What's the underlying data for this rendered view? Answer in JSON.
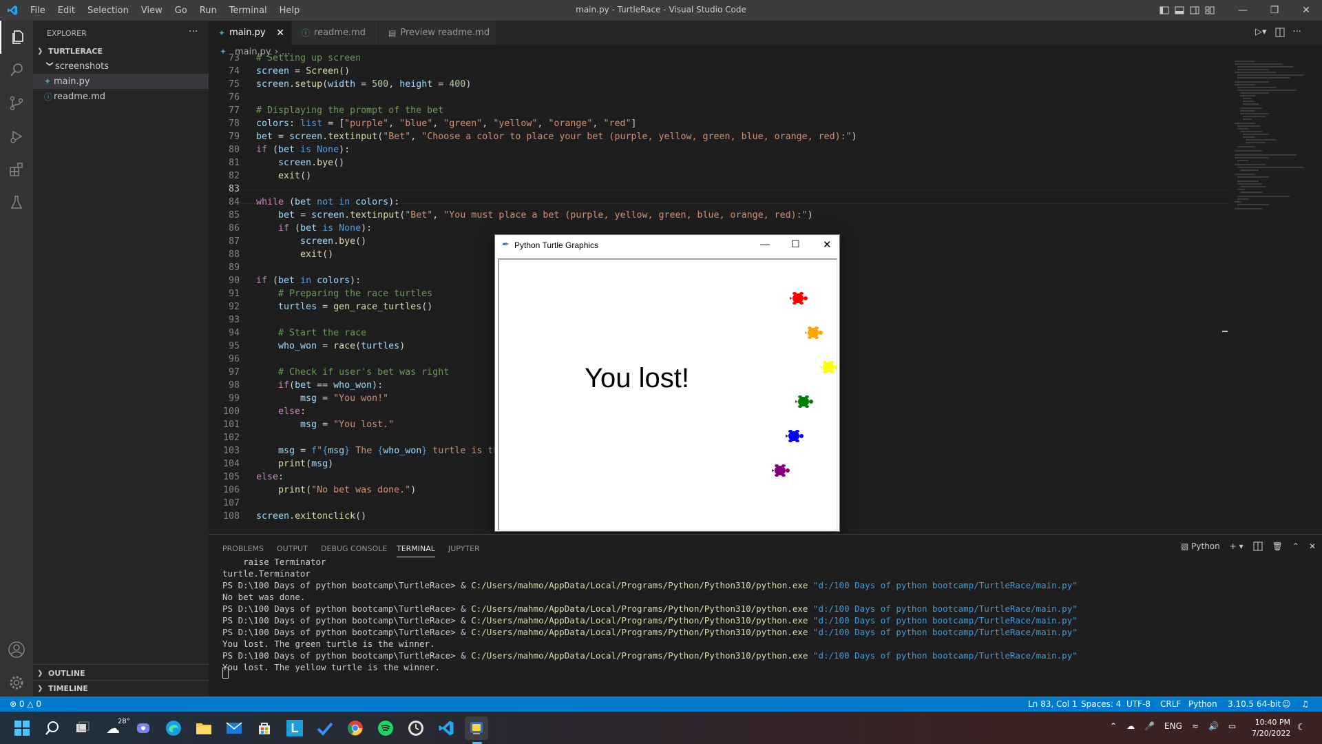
{
  "window": {
    "title": "main.py - TurtleRace - Visual Studio Code",
    "menu": [
      "File",
      "Edit",
      "Selection",
      "View",
      "Go",
      "Run",
      "Terminal",
      "Help"
    ]
  },
  "sidebar": {
    "title": "EXPLORER",
    "more": "···",
    "project": "TURTLERACE",
    "items": [
      {
        "label": "screenshots",
        "icon": "folder-icon"
      },
      {
        "label": "main.py",
        "icon": "python-file-icon"
      },
      {
        "label": "readme.md",
        "icon": "info-icon"
      }
    ],
    "outline": "OUTLINE",
    "timeline": "TIMELINE"
  },
  "tabs": [
    {
      "label": "main.py",
      "active": true
    },
    {
      "label": "readme.md",
      "active": false
    },
    {
      "label": "Preview readme.md",
      "active": false
    }
  ],
  "breadcrumb": {
    "file": "main.py",
    "rest": "..."
  },
  "editor": {
    "current_line": 83,
    "lines": [
      {
        "n": "73",
        "html": "<span class='cm'># Setting up screen</span>"
      },
      {
        "n": "74",
        "html": "<span class='vr'>screen</span> = <span class='fn'>Screen</span>()"
      },
      {
        "n": "75",
        "html": "<span class='vr'>screen</span>.<span class='fn'>setup</span>(<span class='vr'>width</span> = <span class='nm'>500</span>, <span class='vr'>height</span> = <span class='nm'>400</span>)"
      },
      {
        "n": "76",
        "html": ""
      },
      {
        "n": "77",
        "html": "<span class='cm'># Displaying the prompt of the bet</span>"
      },
      {
        "n": "78",
        "html": "<span class='vr'>colors</span>: <span class='bl'>list</span> = [<span class='st'>\"purple\"</span>, <span class='st'>\"blue\"</span>, <span class='st'>\"green\"</span>, <span class='st'>\"yellow\"</span>, <span class='st'>\"orange\"</span>, <span class='st'>\"red\"</span>]"
      },
      {
        "n": "79",
        "html": "<span class='vr'>bet</span> = <span class='vr'>screen</span>.<span class='fn'>textinput</span>(<span class='st'>\"Bet\"</span>, <span class='st'>\"Choose a color to place your bet (purple, yellow, green, blue, orange, red):\"</span>)"
      },
      {
        "n": "80",
        "html": "<span class='kw'>if</span> (<span class='vr'>bet</span> <span class='bl'>is</span> <span class='bl'>None</span>):"
      },
      {
        "n": "81",
        "html": "    <span class='vr'>screen</span>.<span class='fn'>bye</span>()"
      },
      {
        "n": "82",
        "html": "    <span class='fn'>exit</span>()"
      },
      {
        "n": "83",
        "html": ""
      },
      {
        "n": "84",
        "html": "<span class='kw'>while</span> (<span class='vr'>bet</span> <span class='bl'>not in</span> <span class='vr'>colors</span>):"
      },
      {
        "n": "85",
        "html": "    <span class='vr'>bet</span> = <span class='vr'>screen</span>.<span class='fn'>textinput</span>(<span class='st'>\"Bet\"</span>, <span class='st'>\"You must place a bet (purple, yellow, green, blue, orange, red):\"</span>)"
      },
      {
        "n": "86",
        "html": "    <span class='kw'>if</span> (<span class='vr'>bet</span> <span class='bl'>is</span> <span class='bl'>None</span>):"
      },
      {
        "n": "87",
        "html": "        <span class='vr'>screen</span>.<span class='fn'>bye</span>()"
      },
      {
        "n": "88",
        "html": "        <span class='fn'>exit</span>()"
      },
      {
        "n": "89",
        "html": ""
      },
      {
        "n": "90",
        "html": "<span class='kw'>if</span> (<span class='vr'>bet</span> <span class='bl'>in</span> <span class='vr'>colors</span>):"
      },
      {
        "n": "91",
        "html": "    <span class='cm'># Preparing the race turtles</span>"
      },
      {
        "n": "92",
        "html": "    <span class='vr'>turtles</span> = <span class='fn'>gen_race_turtles</span>()"
      },
      {
        "n": "93",
        "html": ""
      },
      {
        "n": "94",
        "html": "    <span class='cm'># Start the race</span>"
      },
      {
        "n": "95",
        "html": "    <span class='vr'>who_won</span> = <span class='fn'>race</span>(<span class='vr'>turtles</span>)"
      },
      {
        "n": "96",
        "html": ""
      },
      {
        "n": "97",
        "html": "    <span class='cm'># Check if user's bet was right</span>"
      },
      {
        "n": "98",
        "html": "    <span class='kw'>if</span>(<span class='vr'>bet</span> == <span class='vr'>who_won</span>):"
      },
      {
        "n": "99",
        "html": "        <span class='vr'>msg</span> = <span class='st'>\"You won!\"</span>"
      },
      {
        "n": "100",
        "html": "    <span class='kw'>else</span>:"
      },
      {
        "n": "101",
        "html": "        <span class='vr'>msg</span> = <span class='st'>\"You lost.\"</span>"
      },
      {
        "n": "102",
        "html": ""
      },
      {
        "n": "103",
        "html": "    <span class='vr'>msg</span> = <span class='bl'>f</span><span class='st'>\"</span><span class='bl'>{</span><span class='vr'>msg</span><span class='bl'>}</span><span class='st'> The </span><span class='bl'>{</span><span class='vr'>who_won</span><span class='bl'>}</span><span class='st'> turtle is the</span>"
      },
      {
        "n": "104",
        "html": "    <span class='fn'>print</span>(<span class='vr'>msg</span>)"
      },
      {
        "n": "105",
        "html": "<span class='kw'>else</span>:"
      },
      {
        "n": "106",
        "html": "    <span class='fn'>print</span>(<span class='st'>\"No bet was done.\"</span>)"
      },
      {
        "n": "107",
        "html": ""
      },
      {
        "n": "108",
        "html": "<span class='vr'>screen</span>.<span class='fn'>exitonclick</span>()"
      }
    ]
  },
  "turtle_window": {
    "title": "Python Turtle Graphics",
    "message": "You lost!",
    "turtles": [
      "#ff0000",
      "#ffa500",
      "#ffff00",
      "#008000",
      "#0000ff",
      "#800080"
    ]
  },
  "panel": {
    "tabs": [
      "PROBLEMS",
      "OUTPUT",
      "DEBUG CONSOLE",
      "TERMINAL",
      "JUPYTER"
    ],
    "active_tab": "TERMINAL",
    "shell": "Python",
    "terminal_lines": [
      {
        "plain": "    raise Terminator"
      },
      {
        "plain": "turtle.Terminator"
      },
      {
        "prompt": "PS D:\\100 Days of python bootcamp\\TurtleRace> & ",
        "path": "C:/Users/mahmo/AppData/Local/Programs/Python/Python310/python.exe",
        "arg": " \"d:/100 Days of python bootcamp/TurtleRace/main.py\""
      },
      {
        "plain": "No bet was done."
      },
      {
        "prompt": "PS D:\\100 Days of python bootcamp\\TurtleRace> & ",
        "path": "C:/Users/mahmo/AppData/Local/Programs/Python/Python310/python.exe",
        "arg": " \"d:/100 Days of python bootcamp/TurtleRace/main.py\""
      },
      {
        "prompt": "PS D:\\100 Days of python bootcamp\\TurtleRace> & ",
        "path": "C:/Users/mahmo/AppData/Local/Programs/Python/Python310/python.exe",
        "arg": " \"d:/100 Days of python bootcamp/TurtleRace/main.py\""
      },
      {
        "prompt": "PS D:\\100 Days of python bootcamp\\TurtleRace> & ",
        "path": "C:/Users/mahmo/AppData/Local/Programs/Python/Python310/python.exe",
        "arg": " \"d:/100 Days of python bootcamp/TurtleRace/main.py\""
      },
      {
        "plain": "You lost. The green turtle is the winner."
      },
      {
        "prompt": "PS D:\\100 Days of python bootcamp\\TurtleRace> & ",
        "path": "C:/Users/mahmo/AppData/Local/Programs/Python/Python310/python.exe",
        "arg": " \"d:/100 Days of python bootcamp/TurtleRace/main.py\""
      },
      {
        "plain": "You lost. The yellow turtle is the winner."
      }
    ]
  },
  "statusbar": {
    "errors": "0",
    "warnings": "0",
    "position": "Ln 83, Col 1",
    "spaces": "Spaces: 4",
    "encoding": "UTF-8",
    "eol": "CRLF",
    "language": "Python",
    "interpreter": "3.10.5 64-bit"
  },
  "taskbar": {
    "weather": "28°",
    "language": "ENG",
    "time": "10:40 PM",
    "date": "7/20/2022"
  }
}
